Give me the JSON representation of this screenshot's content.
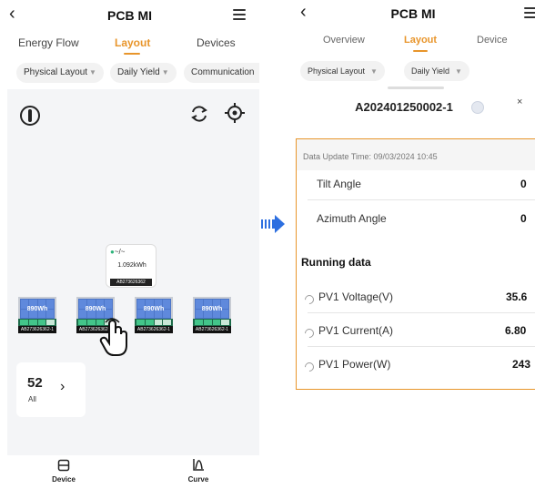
{
  "left": {
    "title": "PCB MI",
    "tabs": [
      {
        "label": "Energy Flow"
      },
      {
        "label": "Layout"
      },
      {
        "label": "Devices"
      }
    ],
    "chips": [
      {
        "label": "Physical Layout"
      },
      {
        "label": "Daily Yield"
      },
      {
        "label": "Communication"
      }
    ],
    "inverter": {
      "status_glyph": "~/~",
      "energy": "1.092kWh",
      "serial": "AB273626362"
    },
    "panels": [
      {
        "yield": "890Wh",
        "serial": "AB273626362-1",
        "level": 0.75
      },
      {
        "yield": "890Wh",
        "serial": "AB273626362-1",
        "level": 0.75
      },
      {
        "yield": "890Wh",
        "serial": "AB273626362-1",
        "level": 0.6
      },
      {
        "yield": "890Wh",
        "serial": "AB273626362-1",
        "level": 0.75
      }
    ],
    "summary": {
      "count": "52",
      "label": "All"
    },
    "bottom_nav": [
      {
        "label": "Device",
        "icon": "device-icon"
      },
      {
        "label": "Curve",
        "icon": "curve-icon"
      }
    ]
  },
  "right": {
    "title": "PCB MI",
    "tabs": [
      {
        "label": "Overview"
      },
      {
        "label": "Layout"
      },
      {
        "label": "Device"
      }
    ],
    "chips": [
      {
        "label": "Physical Layout"
      },
      {
        "label": "Daily Yield"
      }
    ],
    "sheet": {
      "device_id": "A202401250002-1",
      "update_time": "Data Update Time: 09/03/2024 10:45",
      "angles": [
        {
          "label": "Tilt Angle",
          "value": "0"
        },
        {
          "label": "Azimuth Angle",
          "value": "0"
        }
      ],
      "running_title": "Running data",
      "running": [
        {
          "label": "PV1 Voltage(V)",
          "value": "35.6"
        },
        {
          "label": "PV1 Current(A)",
          "value": "6.80"
        },
        {
          "label": "PV1 Power(W)",
          "value": "243"
        }
      ]
    }
  },
  "colors": {
    "accent": "#e8952b",
    "panel_blue": "#4d76c8",
    "arrow_blue": "#2d6fe0"
  }
}
